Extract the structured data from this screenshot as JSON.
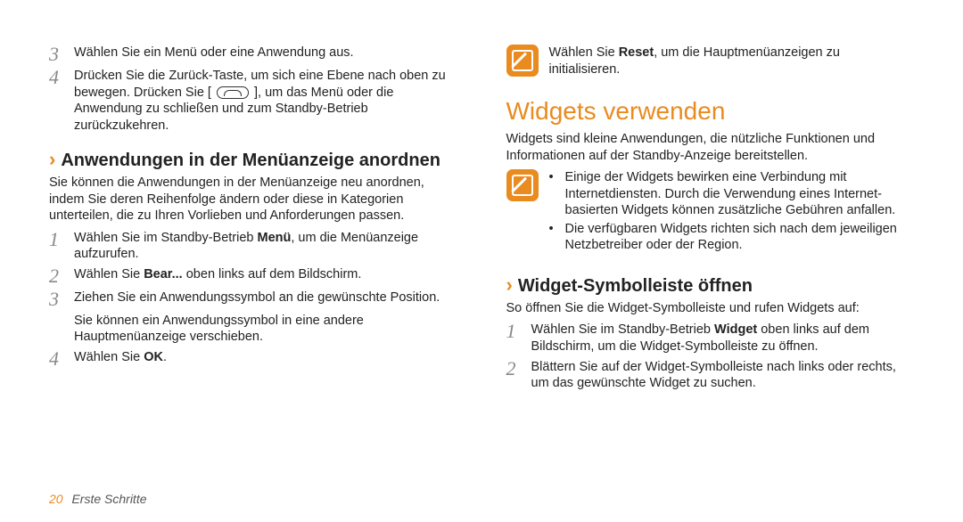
{
  "left": {
    "steps_top": [
      {
        "num": "3",
        "text": "Wählen Sie ein Menü oder eine Anwendung aus."
      },
      {
        "num": "4",
        "text_pre": "Drücken Sie die Zurück-Taste, um sich eine Ebene nach oben zu bewegen. Drücken Sie [",
        "text_post": "], um das Menü oder die Anwendung zu schließen und zum Standby-Betrieb zurückzukehren."
      }
    ],
    "h3": "Anwendungen in der Menüanzeige anordnen",
    "intro": "Sie können die Anwendungen in der Menüanzeige neu anordnen, indem Sie deren Reihenfolge ändern oder diese in Kategorien unterteilen, die zu Ihren Vorlieben und Anforderungen passen.",
    "steps_bottom": [
      {
        "num": "1",
        "html": "Wählen Sie im Standby-Betrieb <strong>Menü</strong>, um die Menüanzeige aufzurufen."
      },
      {
        "num": "2",
        "html": "Wählen Sie <strong>Bear...</strong> oben links auf dem Bildschirm."
      },
      {
        "num": "3",
        "html": "Ziehen Sie ein Anwendungssymbol an die gewünschte Position.",
        "note": "Sie können ein Anwendungssymbol in eine andere Hauptmenüanzeige verschieben."
      },
      {
        "num": "4",
        "html": "Wählen Sie <strong>OK</strong>."
      }
    ]
  },
  "right": {
    "note1": "Wählen Sie <strong>Reset</strong>, um die Hauptmenüanzeigen zu initialisieren.",
    "h2": "Widgets verwenden",
    "intro": "Widgets sind kleine Anwendungen, die nützliche Funktionen und Informationen auf der Standby-Anzeige bereitstellen.",
    "note2_bullets": [
      "Einige der Widgets bewirken eine Verbindung mit Internetdiensten. Durch die Verwendung eines Internet-basierten Widgets können zusätzliche Gebühren anfallen.",
      "Die verfügbaren Widgets richten sich nach dem jeweiligen Netzbetreiber oder der Region."
    ],
    "h3": "Widget-Symbolleiste öffnen",
    "body2": "So öffnen Sie die Widget-Symbolleiste und rufen Widgets auf:",
    "steps": [
      {
        "num": "1",
        "html": "Wählen Sie im Standby-Betrieb <strong>Widget</strong> oben links auf dem Bildschirm, um die Widget-Symbolleiste zu öffnen."
      },
      {
        "num": "2",
        "html": "Blättern Sie auf der Widget-Symbolleiste nach links oder rechts, um das gewünschte Widget zu suchen."
      }
    ]
  },
  "footer": {
    "page": "20",
    "section": "Erste Schritte"
  }
}
